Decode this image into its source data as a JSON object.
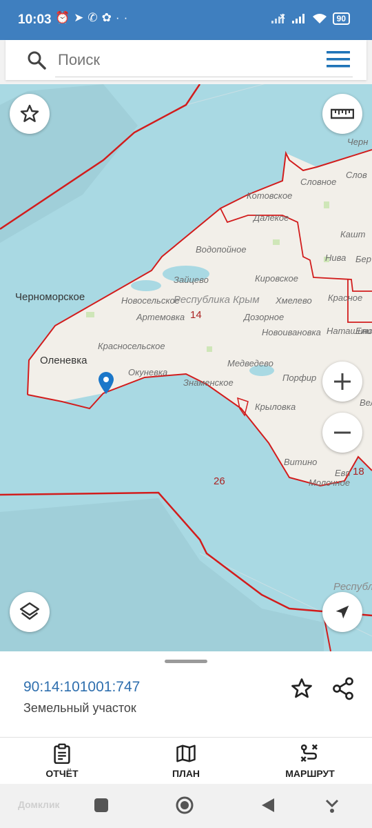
{
  "status_bar": {
    "time": "10:03",
    "left_icons": [
      "alarm-icon",
      "telegram-icon",
      "whatsapp-icon",
      "app-icon",
      "more-dots-icon"
    ],
    "right_icons": [
      "signal-off-icon",
      "signal-icon",
      "wifi-icon"
    ],
    "battery": "90"
  },
  "search": {
    "placeholder": "Поиск"
  },
  "map": {
    "labels": {
      "chernomorskoe": "Черноморское",
      "olenevka": "Оленевка",
      "novoselskoe": "Новосельское",
      "artemovka": "Артемовка",
      "krasnoselskoe": "Красносельское",
      "okunevka": "Окуневка",
      "znamenskoe": "Знаменское",
      "medvedevo": "Медведево",
      "krylovka": "Крыловка",
      "vitino": "Витино",
      "molochnoe": "Молочное",
      "vodopoynoe": "Водопойное",
      "zaytsevo": "Зайцево",
      "kirovskoe": "Кировское",
      "dozornoe": "Дозорное",
      "novoivanovka": "Новоивановка",
      "khmelevo": "Хмелево",
      "krasnoe": "Красное",
      "nataschino": "Наташино",
      "porfir": "Порфир",
      "kotovskoe": "Котовское",
      "dalekoe": "Далекое",
      "slovnoe": "Словное",
      "slov": "Слов",
      "kasht": "Кашт",
      "niva": "Нива",
      "ber": "Бер",
      "chern": "Черн",
      "el": "Ели",
      "vel": "Вел",
      "eup": "Евп",
      "region": "Республика Крым",
      "region2": "Республ",
      "num14": "14",
      "num26": "26",
      "num18": "18"
    }
  },
  "place": {
    "cadastral_number": "90:14:101001:747",
    "type": "Земельный участок"
  },
  "actions": {
    "report": "ОТЧЁТ",
    "plan": "ПЛАН",
    "route": "МАРШРУТ"
  },
  "navbar": {
    "watermark": "Домклик"
  },
  "colors": {
    "status_bar": "#3f7fbf",
    "sea": "#a9d9e3",
    "land": "#f2efe9",
    "border": "#d21c1c",
    "link": "#2f6fae",
    "pin": "#1b77c9"
  }
}
